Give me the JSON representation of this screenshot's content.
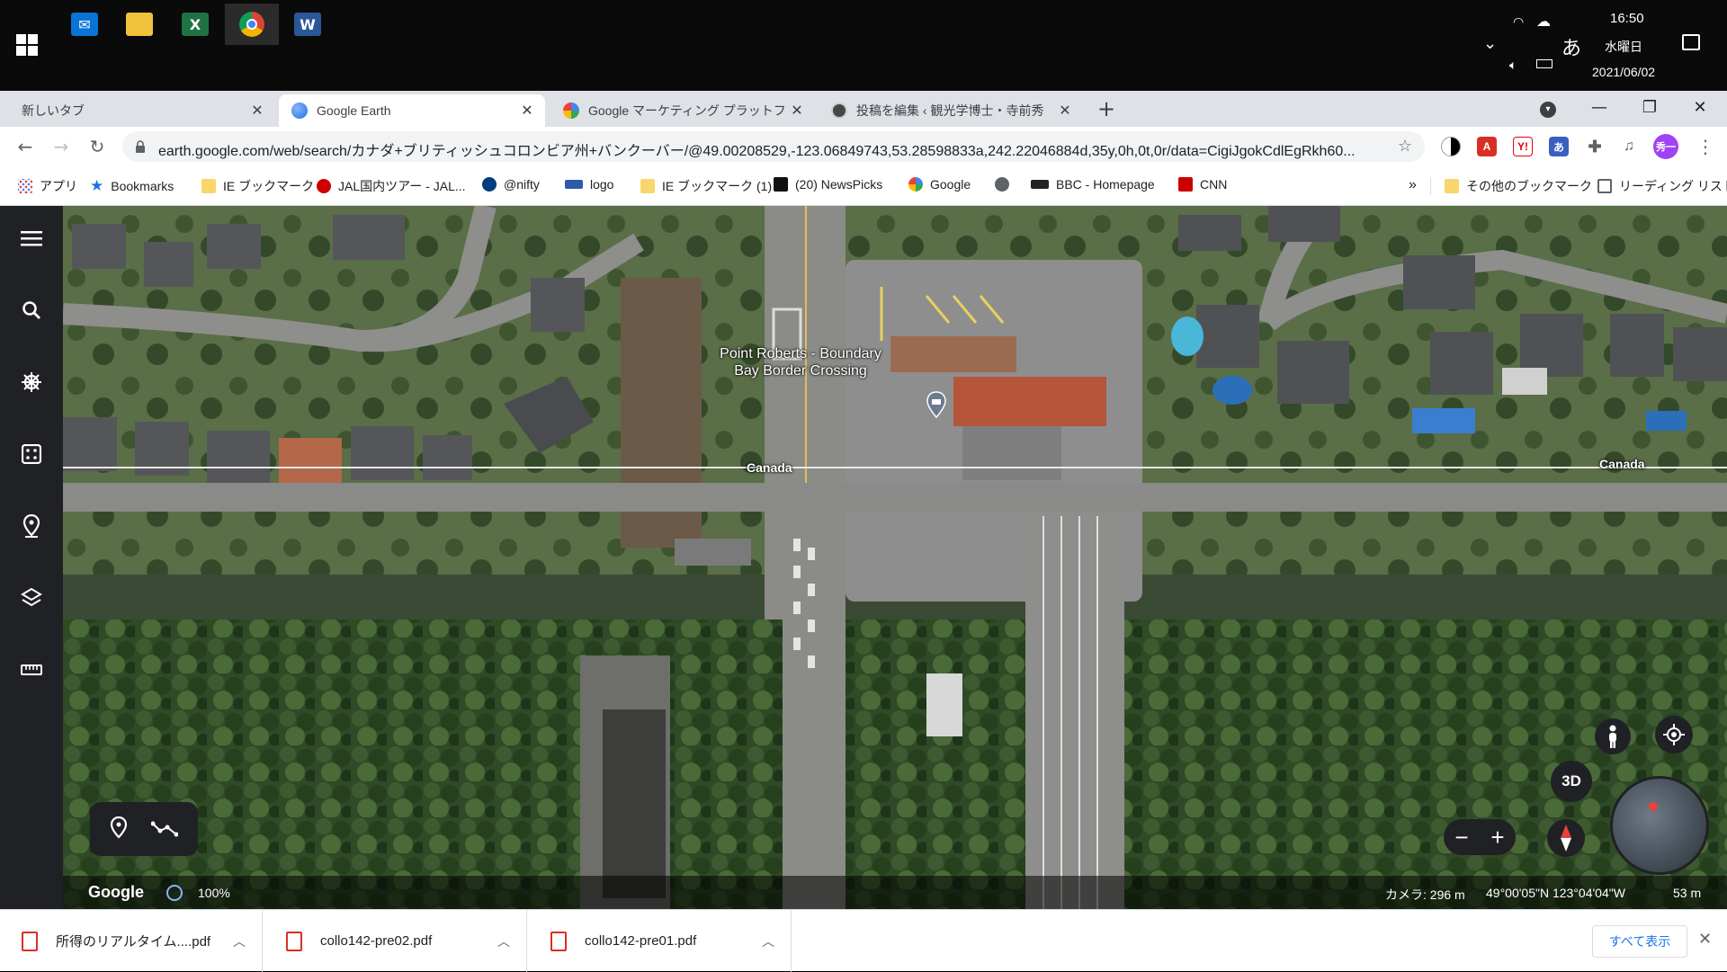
{
  "taskbar": {
    "apps": [
      {
        "name": "mail",
        "color": "#0a74d6"
      },
      {
        "name": "file-explorer",
        "color": "#f0c23b"
      },
      {
        "name": "excel",
        "color": "#1f7244",
        "glyph": "X"
      },
      {
        "name": "chrome",
        "color": "#db4437"
      },
      {
        "name": "word",
        "color": "#2b579a",
        "glyph": "W"
      }
    ],
    "ime": "あ",
    "time": "16:50",
    "weekday": "水曜日",
    "date": "2021/06/02"
  },
  "tabs": [
    {
      "label": "新しいタブ",
      "active": false
    },
    {
      "label": "Google Earth",
      "active": true
    },
    {
      "label": "Google マーケティング プラットフォーム",
      "active": false
    },
    {
      "label": "投稿を編集 ‹ 観光学博士・寺前秀",
      "active": false
    }
  ],
  "address": {
    "url": "earth.google.com/web/search/カナダ+ブリティッシュコロンビア州+バンクーバー/@49.00208529,-123.06849743,53.28598833a,242.22046884d,35y,0h,0t,0r/data=CigiJgokCdlEgRkh60..."
  },
  "profile_initial": "秀一",
  "bookmarks": [
    {
      "label": "アプリ",
      "icon": "apps-icon",
      "color": "#ea4335"
    },
    {
      "label": "Bookmarks",
      "icon": "star-icon",
      "color": "#1a73e8"
    },
    {
      "label": "IE ブックマーク",
      "icon": "folder-icon",
      "color": "#f9d66b"
    },
    {
      "label": "JAL国内ツアー - JAL...",
      "icon": "jal-icon",
      "color": "#cc0000"
    },
    {
      "label": "@nifty",
      "icon": "nifty-icon",
      "color": "#003d7a"
    },
    {
      "label": "logo",
      "icon": "vsa-icon",
      "color": "#2d5ca8"
    },
    {
      "label": "IE ブックマーク (1)",
      "icon": "folder-icon",
      "color": "#f9d66b"
    },
    {
      "label": "(20) NewsPicks",
      "icon": "newspicks-icon",
      "color": "#111111"
    },
    {
      "label": "Google",
      "icon": "google-icon",
      "color": "#4285f4"
    },
    {
      "label": "",
      "icon": "globe-icon",
      "color": "#5f6368"
    },
    {
      "label": "BBC - Homepage",
      "icon": "bbc-icon",
      "color": "#222222"
    },
    {
      "label": "CNN",
      "icon": "cnn-icon",
      "color": "#cc0000"
    }
  ],
  "bookmarks_overflow": "»",
  "other_bookmarks": "その他のブックマーク",
  "reading_list": "リーディング リスト",
  "earth": {
    "place_label": "Point Roberts - Boundary Bay Border Crossing",
    "place_line1": "Point Roberts - Boundary",
    "place_line2": "Bay Border Crossing",
    "border_label_left": "Canada",
    "border_label_right": "Canada",
    "button_3d": "3D",
    "google_logo": "Google",
    "zoom": "100%",
    "camera": "カメラ: 296 m",
    "coords": "49°00'05\"N 123°04'04\"W",
    "scale": "53 m"
  },
  "downloads": {
    "items": [
      {
        "name": "所得のリアルタイム....pdf"
      },
      {
        "name": "collo142-pre02.pdf"
      },
      {
        "name": "collo142-pre01.pdf"
      }
    ],
    "show_all": "すべて表示"
  }
}
